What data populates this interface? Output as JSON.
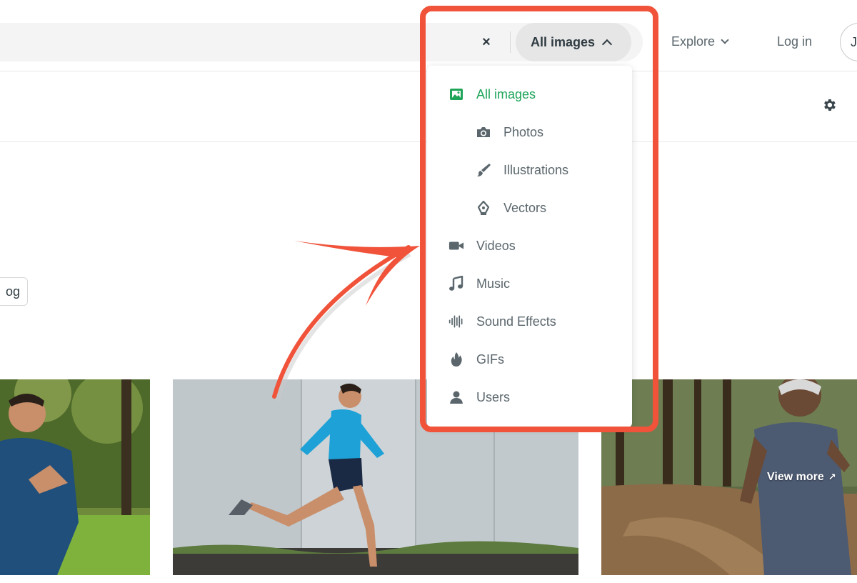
{
  "header": {
    "clear_symbol": "×",
    "type_select_label": "All images",
    "explore_label": "Explore",
    "login_label": "Log in",
    "join_label": "J"
  },
  "filter_chip_label": "og",
  "dropdown": {
    "items": [
      {
        "label": "All images",
        "icon": "image-icon",
        "active": true
      },
      {
        "label": "Photos",
        "icon": "camera-icon"
      },
      {
        "label": "Illustrations",
        "icon": "brush-icon"
      },
      {
        "label": "Vectors",
        "icon": "pen-nib-icon"
      },
      {
        "label": "Videos",
        "icon": "video-camera-icon"
      },
      {
        "label": "Music",
        "icon": "music-note-icon"
      },
      {
        "label": "Sound Effects",
        "icon": "waveform-icon"
      },
      {
        "label": "GIFs",
        "icon": "flame-icon"
      },
      {
        "label": "Users",
        "icon": "user-icon"
      }
    ]
  },
  "photos": [
    {
      "description_icon": "photo-runner-park"
    },
    {
      "description_icon": "photo-runner-wall"
    },
    {
      "description_icon": "photo-runner-forest",
      "overlay_label": "View more"
    }
  ],
  "colors": {
    "accent_green": "#1fa55a",
    "annotation_red": "#f0533a",
    "text_dark": "#2f3b41",
    "text_muted": "#5a666c"
  }
}
